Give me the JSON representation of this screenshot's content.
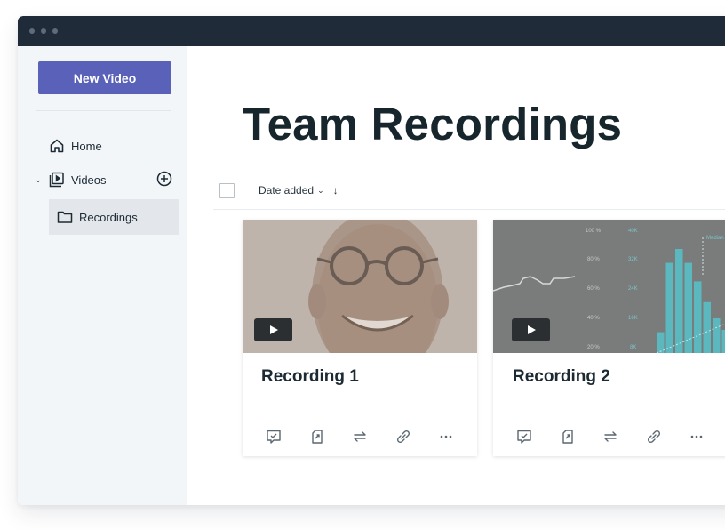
{
  "window": {
    "titlebar_dots": 3,
    "colors": {
      "titlebar": "#1f2b38",
      "sidebar_bg": "#f3f6f9",
      "primary_button": "#5a61b8",
      "selected_nav_bg": "#e3e7eb",
      "chart_bar": "#5ab8be"
    }
  },
  "sidebar": {
    "new_video_label": "New Video",
    "items": [
      {
        "label": "Home",
        "icon": "home-icon"
      },
      {
        "label": "Videos",
        "icon": "video-library-icon",
        "expanded": true,
        "action_icon": "add-circle-icon"
      },
      {
        "label": "Recordings",
        "icon": "folder-icon",
        "selected": true
      }
    ]
  },
  "main": {
    "title": "Team Recordings",
    "toolbar": {
      "select_all_checked": false,
      "sort_label": "Date added",
      "sort_direction_icon": "arrow-down-icon"
    },
    "cards": [
      {
        "title": "Recording 1",
        "thumbnail": "smiling-man-with-glasses",
        "actions": [
          "comment-check-icon",
          "export-file-icon",
          "swap-icon",
          "link-icon",
          "more-icon"
        ]
      },
      {
        "title": "Recording 2",
        "thumbnail": "analytics-chart",
        "thumbnail_labels": {
          "percent_axis": [
            "100 %",
            "80 %",
            "60 %",
            "40 %",
            "20 %"
          ],
          "count_axis": [
            "40K",
            "32K",
            "24K",
            "16K",
            "8K"
          ],
          "annotation": "Median"
        },
        "actions": [
          "comment-check-icon",
          "export-file-icon",
          "swap-icon",
          "link-icon",
          "more-icon"
        ]
      }
    ]
  }
}
